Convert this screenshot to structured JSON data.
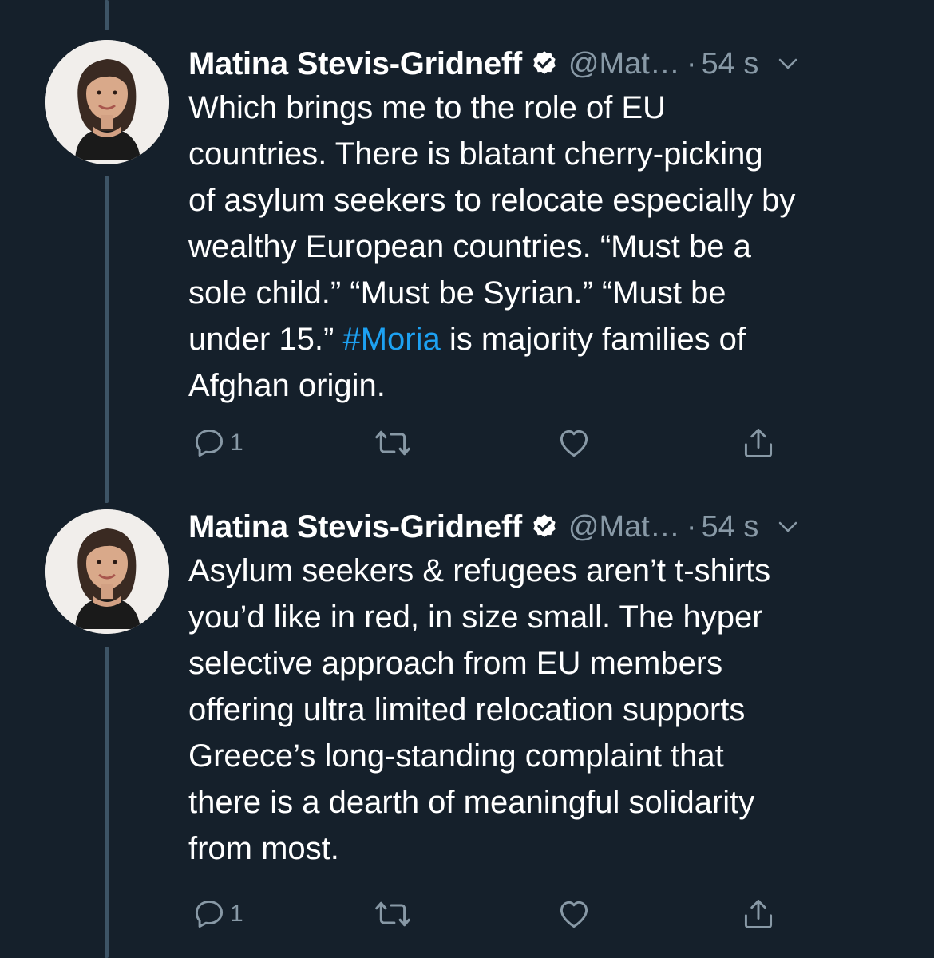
{
  "colors": {
    "background": "#15202b",
    "text": "#ffffff",
    "secondary_text": "#8899a6",
    "hashtag": "#1da1f2",
    "thread_line": "#3d5466"
  },
  "tweets": [
    {
      "author_name": "Matina Stevis-Gridneff",
      "verified": true,
      "handle": "@Mat…",
      "separator": "·",
      "time": "54 s",
      "text_before": "Which brings me to the role of EU\ncountries. There is blatant cherry-picking\nof asylum seekers to relocate especially by\nwealthy European countries. “Must be a\nsole child.” “Must be Syrian.” “Must be\nunder 15.” ",
      "hashtag": "#Moria",
      "text_after": " is majority families of\nAfghan origin.",
      "reply_count": "1",
      "icons": [
        "verified-icon",
        "chevron-down-icon",
        "reply-icon",
        "retweet-icon",
        "like-icon",
        "share-icon"
      ]
    },
    {
      "author_name": "Matina Stevis-Gridneff",
      "verified": true,
      "handle": "@Mat…",
      "separator": "·",
      "time": "54 s",
      "text_before": "Asylum seekers & refugees aren’t t-shirts\nyou’d like in red, in size small. The hyper\nselective approach from EU members\noffering ultra limited relocation supports\nGreece’s long-standing complaint that\nthere is a dearth of meaningful solidarity\nfrom most.",
      "hashtag": "",
      "text_after": "",
      "reply_count": "1",
      "icons": [
        "verified-icon",
        "chevron-down-icon",
        "reply-icon",
        "retweet-icon",
        "like-icon",
        "share-icon"
      ]
    }
  ]
}
